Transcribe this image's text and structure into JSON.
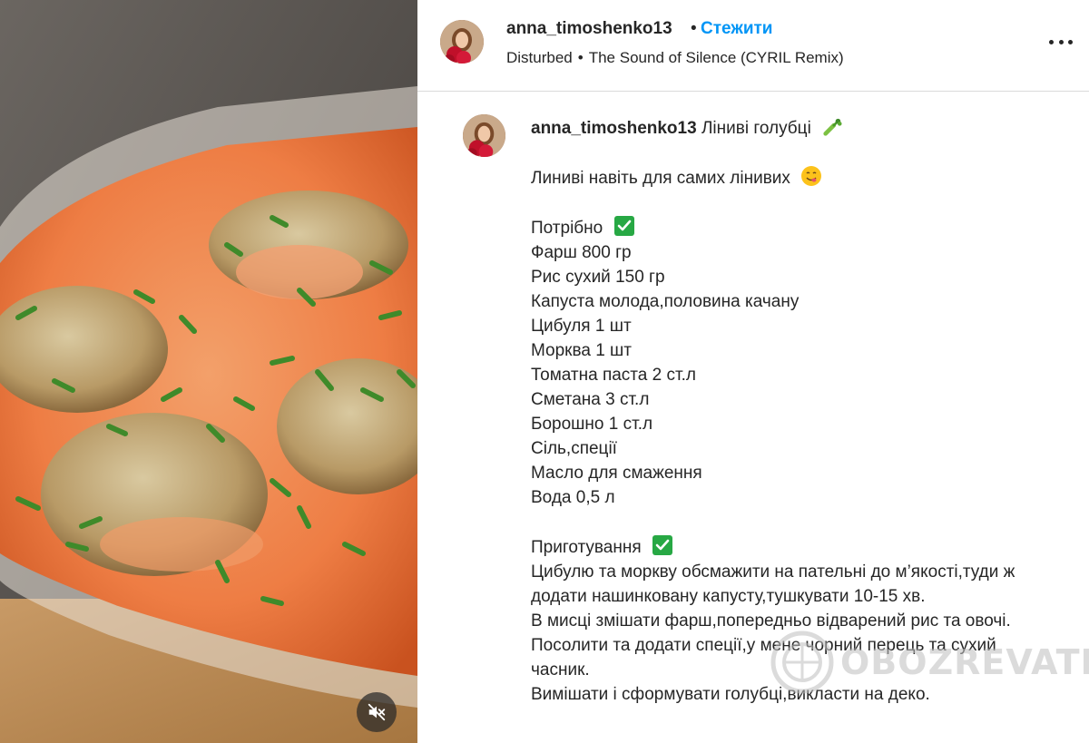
{
  "header": {
    "username": "anna_timoshenko13",
    "separator": "•",
    "follow_label": "Стежити",
    "music_artist": "Disturbed",
    "music_separator": "•",
    "music_track": "The Sound of Silence (CYRIL Remix)"
  },
  "caption": {
    "username": "anna_timoshenko13",
    "title": "Ліниві голубці",
    "tagline": "Линиві навіть для самих лінивих",
    "ingredients_heading": "Потрібно",
    "ingredients": [
      "Фарш 800 гр",
      "Рис сухий 150 гр",
      "Капуста молода,половина качану",
      "Цибуля 1 шт",
      "Морква 1 шт",
      "Томатна паста 2 ст.л",
      "Сметана 3 ст.л",
      "Борошно 1 ст.л",
      "Сіль,спеції",
      "Масло для смаження",
      "Вода 0,5 л"
    ],
    "steps_heading": "Приготування",
    "steps": [
      "Цибулю та моркву обсмажити на пательні до м’якості,туди ж додати нашинковану капусту,тушкувати 10-15 хв.",
      "В мисці змішати фарш,попередньо відварений рис та овочі.",
      "Посолити та додати спеції,у мене чорний перець та сухий часник.",
      "Вимішати і сформувати голубці,викласти на деко."
    ]
  },
  "watermark": {
    "text": "OBOZREVATEL"
  },
  "icons": {
    "mute": "speaker-muted-icon",
    "more": "more-options-icon",
    "celery": "celery-emoji",
    "smile": "yum-face-emoji",
    "check": "check-mark-emoji"
  },
  "colors": {
    "link": "#0095f6",
    "text": "#262626",
    "divider": "#dbdbdb",
    "check_green": "#27a844"
  }
}
